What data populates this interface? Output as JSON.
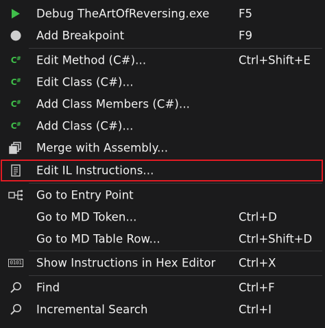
{
  "menu": {
    "items": [
      {
        "label": "Debug TheArtOfReversing.exe",
        "shortcut": "F5",
        "icon": "play-icon"
      },
      {
        "label": "Add Breakpoint",
        "shortcut": "F9",
        "icon": "breakpoint-icon"
      },
      {
        "label": "Edit Method (C#)...",
        "shortcut": "Ctrl+Shift+E",
        "icon": "csharp-icon"
      },
      {
        "label": "Edit Class (C#)...",
        "shortcut": "",
        "icon": "csharp-icon"
      },
      {
        "label": "Add Class Members (C#)...",
        "shortcut": "",
        "icon": "csharp-icon"
      },
      {
        "label": "Add Class (C#)...",
        "shortcut": "",
        "icon": "csharp-icon"
      },
      {
        "label": "Merge with Assembly...",
        "shortcut": "",
        "icon": "merge-icon"
      },
      {
        "label": "Edit IL Instructions...",
        "shortcut": "",
        "icon": "document-icon"
      },
      {
        "label": "Go to Entry Point",
        "shortcut": "",
        "icon": "entry-point-icon"
      },
      {
        "label": "Go to MD Token...",
        "shortcut": "Ctrl+D",
        "icon": ""
      },
      {
        "label": "Go to MD Table Row...",
        "shortcut": "Ctrl+Shift+D",
        "icon": ""
      },
      {
        "label": "Show Instructions in Hex Editor",
        "shortcut": "Ctrl+X",
        "icon": "hex-icon"
      },
      {
        "label": "Find",
        "shortcut": "Ctrl+F",
        "icon": "search-icon"
      },
      {
        "label": "Incremental Search",
        "shortcut": "Ctrl+I",
        "icon": "search-icon"
      }
    ],
    "csharp_icon_text": "C",
    "csharp_icon_sup": "#",
    "hex_icon_text": "0101",
    "colors": {
      "background": "#1b1b1c",
      "text": "#f1f1f1",
      "play": "#3fbf4a",
      "csharp": "#3fbf4a",
      "highlight_border": "#e31b23",
      "separator": "#3a3a3c"
    }
  }
}
